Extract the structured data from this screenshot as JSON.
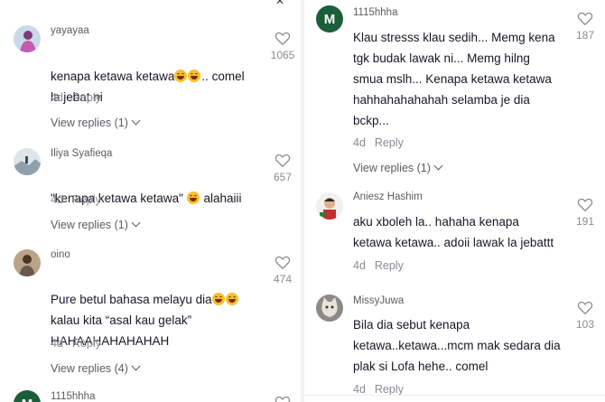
{
  "left_column": {
    "comments": [
      {
        "username": "yayayaa",
        "avatar": "user-avatar-pink-figure",
        "text_parts": [
          "kenapa ketawa ketawa",
          "emoji",
          "emoji",
          ".. comel\nla jebat ni"
        ],
        "time": "4d",
        "reply_label": "Reply",
        "likes": "1065",
        "view_replies": "View replies (1)"
      },
      {
        "username": "Iliya Syafieqa",
        "avatar": "user-avatar-snow-landscape",
        "text_parts": [
          "\"kenapa ketawa ketawa\" ",
          "emoji",
          " alahaiii"
        ],
        "time": "4d",
        "reply_label": "Reply",
        "likes": "657",
        "view_replies": "View replies (1)"
      },
      {
        "username": "oino",
        "avatar": "user-avatar-photo",
        "text_parts": [
          "Pure betul bahasa melayu dia",
          "emoji",
          "emoji",
          "\nkalau kita “asal kau gelak”\nHAHAAHAHAHAHAH"
        ],
        "time": "4d",
        "reply_label": "Reply",
        "likes": "474",
        "view_replies": "View replies (4)"
      },
      {
        "username": "1115hhha",
        "avatar_letter": "M"
      }
    ]
  },
  "right_column": {
    "comments": [
      {
        "username": "1115hhha",
        "avatar_letter": "M",
        "text": "Klau stresss klau sedih... Memg kena\ntgk budak lawak ni... Memg hilng\nsmua mslh... Kenapa ketawa ketawa\nhahhahahahahah selamba je dia\nbckp...",
        "time": "4d",
        "reply_label": "Reply",
        "likes": "187",
        "view_replies": "View replies (1)"
      },
      {
        "username": "Aniesz Hashim",
        "avatar": "user-avatar-cartoon",
        "text": "aku xboleh la.. hahaha kenapa\nketawa ketawa.. adoii lawak la jebattt",
        "time": "4d",
        "reply_label": "Reply",
        "likes": "191"
      },
      {
        "username": "MissyJuwa",
        "avatar": "user-avatar-cat",
        "text": "Bila dia sebut kenapa\nketawa..ketawa...mcm mak sedara dia\nplak si Lofa hehe.. comel",
        "time": "4d",
        "reply_label": "Reply",
        "likes": "103"
      }
    ]
  },
  "icons": {
    "like": "heart-outline-icon",
    "expand": "chevron-down-icon",
    "close": "close-icon",
    "emoji": "grinning-sweat-emoji"
  },
  "colors": {
    "avatar_letter_bg": "#1b5e3a",
    "muted_text": "#8a8b91",
    "primary_text": "#161823"
  }
}
